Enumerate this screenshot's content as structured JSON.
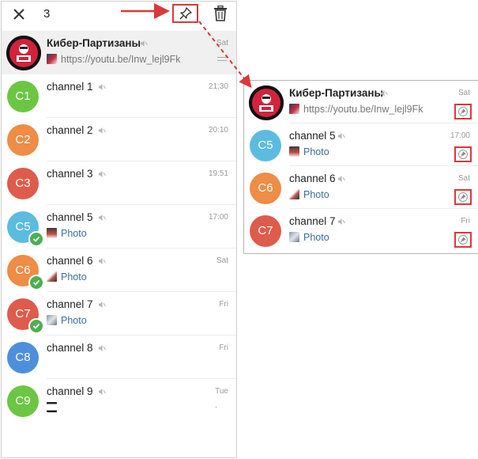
{
  "toolbar": {
    "selected_count": "3"
  },
  "colors": {
    "accent_red": "#d9393a",
    "check_green": "#4caf50",
    "photo_blue": "#3a6d99"
  },
  "left_chats": [
    {
      "name": "Кибер-Партизаны",
      "time": "Sat",
      "preview": "https://youtu.be/Inw_lejl9Fk",
      "avatar_text": "",
      "avatar_color": "#ffffff",
      "selected": true
    },
    {
      "name": "channel 1",
      "time": "21:30",
      "preview": "",
      "avatar_text": "C1",
      "avatar_color": "#6cc643"
    },
    {
      "name": "channel 2",
      "time": "20:10",
      "preview": "",
      "avatar_text": "C2",
      "avatar_color": "#ef8c45"
    },
    {
      "name": "channel 3",
      "time": "19:51",
      "preview": "",
      "avatar_text": "C3",
      "avatar_color": "#df5b4b"
    },
    {
      "name": "channel 5",
      "time": "17:00",
      "preview": "Photo",
      "avatar_text": "C5",
      "avatar_color": "#5bbcdf",
      "checked": true
    },
    {
      "name": "channel 6",
      "time": "Sat",
      "preview": "Photo",
      "avatar_text": "C6",
      "avatar_color": "#ef8c45",
      "checked": true
    },
    {
      "name": "channel 7",
      "time": "Fri",
      "preview": "Photo",
      "avatar_text": "C7",
      "avatar_color": "#df5b4b",
      "checked": true
    },
    {
      "name": "channel 8",
      "time": "Fri",
      "preview": "",
      "avatar_text": "C8",
      "avatar_color": "#4e8fdb"
    },
    {
      "name": "channel 9",
      "time": "Tue",
      "preview": "",
      "avatar_text": "C9",
      "avatar_color": "#6cc643"
    }
  ],
  "zoom_chats": [
    {
      "name": "Кибер-Партизаны",
      "time": "Sat",
      "preview": "https://youtu.be/Inw_lejl9Fk"
    },
    {
      "name": "channel 5",
      "time": "17:00",
      "preview": "Photo",
      "avatar_text": "C5",
      "avatar_color": "#5bbcdf"
    },
    {
      "name": "channel 6",
      "time": "Sat",
      "preview": "Photo",
      "avatar_text": "C6",
      "avatar_color": "#ef8c45"
    },
    {
      "name": "channel 7",
      "time": "Fri",
      "preview": "Photo",
      "avatar_text": "C7",
      "avatar_color": "#df5b4b"
    }
  ]
}
